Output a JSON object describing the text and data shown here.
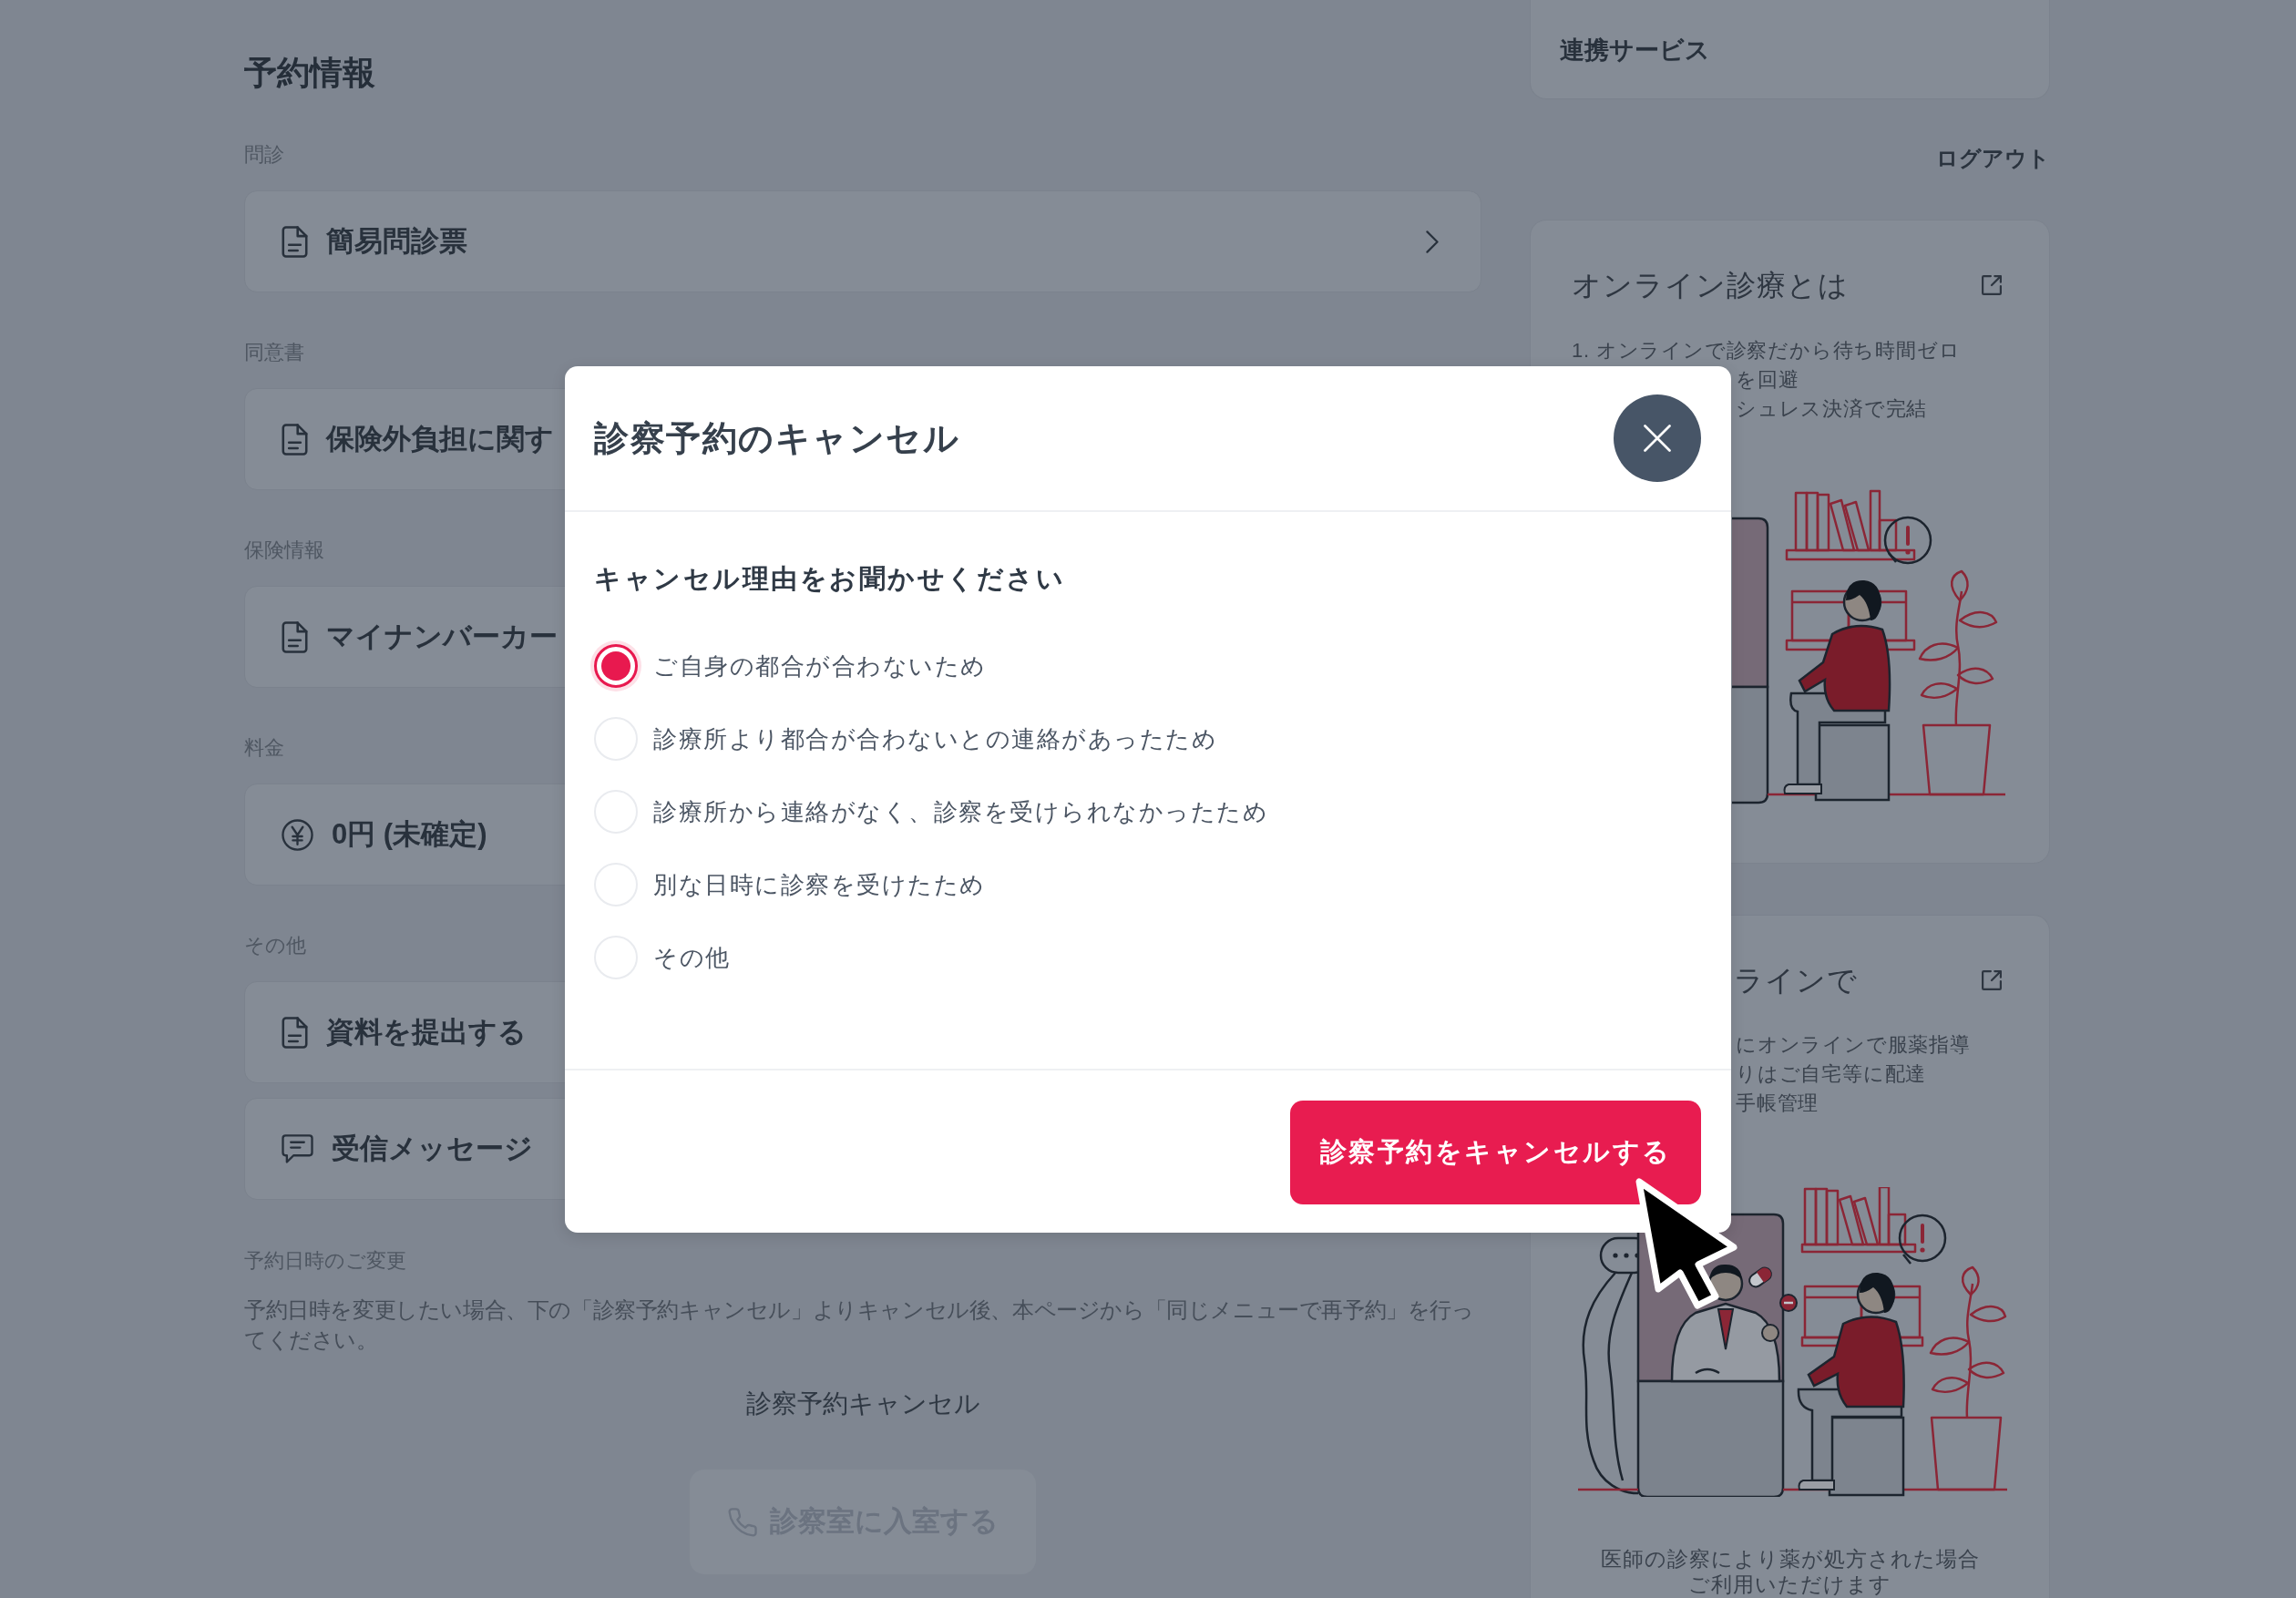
{
  "reservation": {
    "title": "予約情報",
    "sections": [
      {
        "label": "問診",
        "items": [
          {
            "kind": "document",
            "text": "簡易問診票",
            "covered": false
          }
        ]
      },
      {
        "label": "同意書",
        "items": [
          {
            "kind": "document",
            "text": "保険外負担に関す",
            "covered": true
          }
        ]
      },
      {
        "label": "保険情報",
        "items": [
          {
            "kind": "document",
            "text": "マイナンバーカー",
            "covered": true
          }
        ]
      },
      {
        "label": "料金",
        "items": [
          {
            "kind": "yen",
            "text": "0円 (未確定)",
            "covered": true
          }
        ]
      },
      {
        "label": "その他",
        "items": [
          {
            "kind": "document",
            "text": "資料を提出する",
            "covered": true
          },
          {
            "kind": "message",
            "text": "受信メッセージ",
            "covered": true
          }
        ]
      }
    ]
  },
  "date_change": {
    "label": "予約日時のご変更",
    "text": "予約日時を変更したい場合、下の「診察予約キャンセル」よりキャンセル後、本ページから「同じメニューで再予約」を行ってください。"
  },
  "cancel_link": "診察予約キャンセル",
  "enter_button": {
    "label": "診察室に入室する",
    "disabled": true
  },
  "sidebar": {
    "linked_services": "連携サービス",
    "logout": "ログアウト",
    "info_cards": [
      {
        "title": {
          "text": "オンライン診療とは",
          "covered": false
        },
        "lines": [
          "1. オンラインで診察だから待ち時間ゼロ"
        ],
        "cut_lines": [
          "を回避",
          "シュレス決済で完結"
        ]
      },
      {
        "title": {
          "text": "ラインで",
          "covered": true
        },
        "cut_lines": [
          "にオンラインで服薬指導",
          "りはご自宅等に配達",
          "手帳管理"
        ],
        "note": [
          "医師の診察により薬が処方された場合",
          "ご利用いただけます"
        ]
      }
    ]
  },
  "dialog": {
    "title": "診察予約のキャンセル",
    "question": "キャンセル理由をお聞かせください",
    "reasons": [
      {
        "label": "ご自身の都合が合わないため",
        "selected": true
      },
      {
        "label": "診療所より都合が合わないとの連絡があったため",
        "selected": false
      },
      {
        "label": "診療所から連絡がなく、診察を受けられなかったため",
        "selected": false
      },
      {
        "label": "別な日時に診察を受けたため",
        "selected": false
      },
      {
        "label": "その他",
        "selected": false
      }
    ],
    "submit": "診察予約をキャンセルする"
  }
}
